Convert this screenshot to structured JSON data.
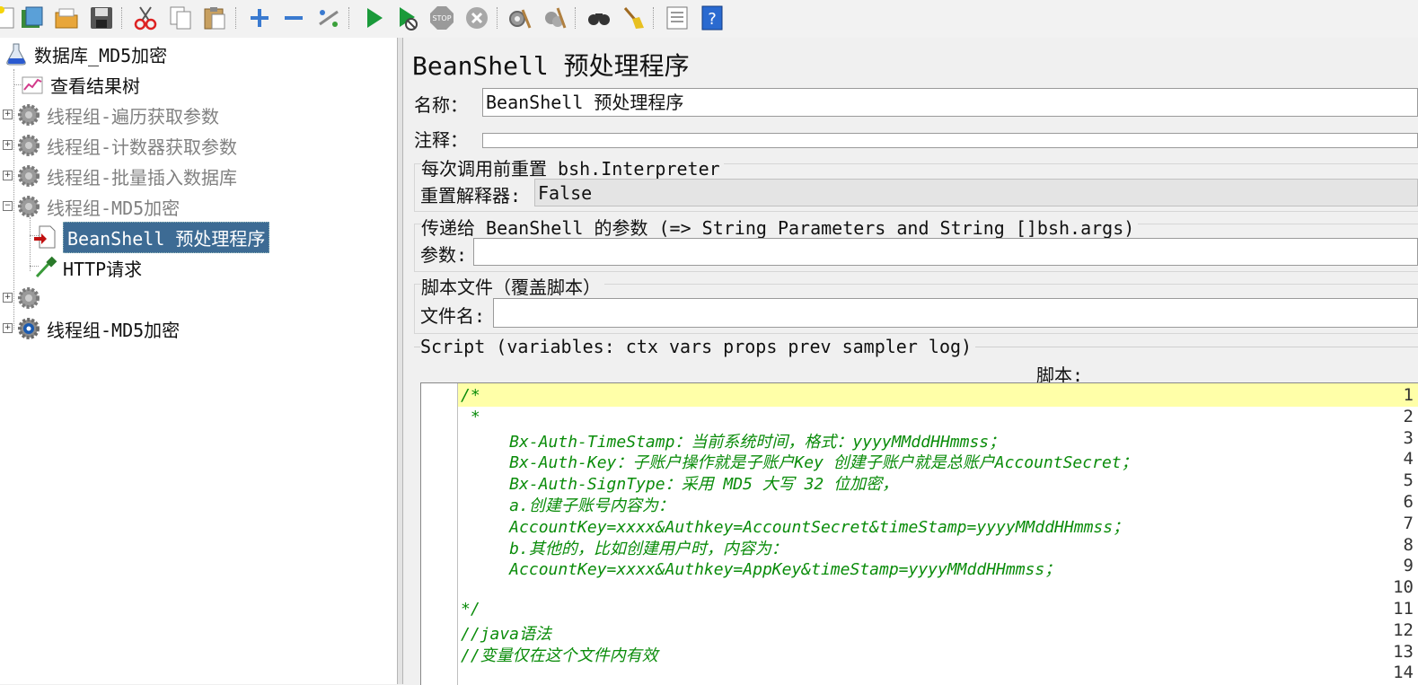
{
  "toolbar": {
    "buttons": [
      "new-icon",
      "templates-icon",
      "open-icon",
      "save-icon",
      "cut-icon",
      "copy-icon",
      "paste-icon",
      "expand-icon",
      "collapse-icon",
      "toggle-icon",
      "start-icon",
      "start-no-pause-icon",
      "stop-icon",
      "shutdown-icon",
      "clear-icon",
      "clear-all-icon",
      "search-icon",
      "reset-search-icon",
      "function-helper-icon",
      "help-icon"
    ],
    "stop_label": "STOP",
    "help_label": "?"
  },
  "tree": {
    "root": "数据库_MD5加密",
    "items": [
      {
        "label": "查看结果树"
      },
      {
        "label": "线程组-遍历获取参数"
      },
      {
        "label": "线程组-计数器获取参数"
      },
      {
        "label": "线程组-批量插入数据库"
      },
      {
        "label": "线程组-MD5加密"
      },
      {
        "label": "BeanShell 预处理程序"
      },
      {
        "label": "HTTP请求"
      },
      {
        "label": ""
      },
      {
        "label": "线程组-MD5加密"
      }
    ]
  },
  "panel": {
    "title": "BeanShell 预处理程序",
    "name_label": "名称：",
    "name_value": "BeanShell 预处理程序",
    "comment_label": "注释：",
    "comment_value": "",
    "reset_group_title": "每次调用前重置 bsh.Interpreter",
    "reset_label": "重置解释器:",
    "reset_value": "False",
    "params_group_title": "传递给 BeanShell 的参数 (=> String Parameters and String []bsh.args)",
    "params_label": "参数:",
    "params_value": "",
    "file_group_title": "脚本文件（覆盖脚本）",
    "file_label": "文件名:",
    "file_value": "",
    "script_group_title": "Script (variables: ctx vars props prev sampler log)",
    "script_label": "脚本:"
  },
  "script": {
    "line_numbers": [
      "1",
      "2",
      "3",
      "4",
      "5",
      "6",
      "7",
      "8",
      "9",
      "10",
      "11",
      "12",
      "13",
      "14"
    ],
    "lines": [
      "/*",
      " *",
      "     Bx-Auth-TimeStamp：当前系统时间，格式：yyyyMMddHHmmss；",
      "     Bx-Auth-Key：子账户操作就是子账户Key 创建子账户就是总账户AccountSecret；",
      "     Bx-Auth-SignType：采用 MD5 大写 32 位加密，",
      "     a.创建子账号内容为：",
      "     AccountKey=xxxx&Authkey=AccountSecret&timeStamp=yyyyMMddHHmmss；",
      "     b.其他的，比如创建用户时，内容为：",
      "     AccountKey=xxxx&Authkey=AppKey&timeStamp=yyyyMMddHHmmss；",
      "",
      "*/",
      "//java语法",
      "//变量仅在这个文件内有效",
      ""
    ]
  }
}
